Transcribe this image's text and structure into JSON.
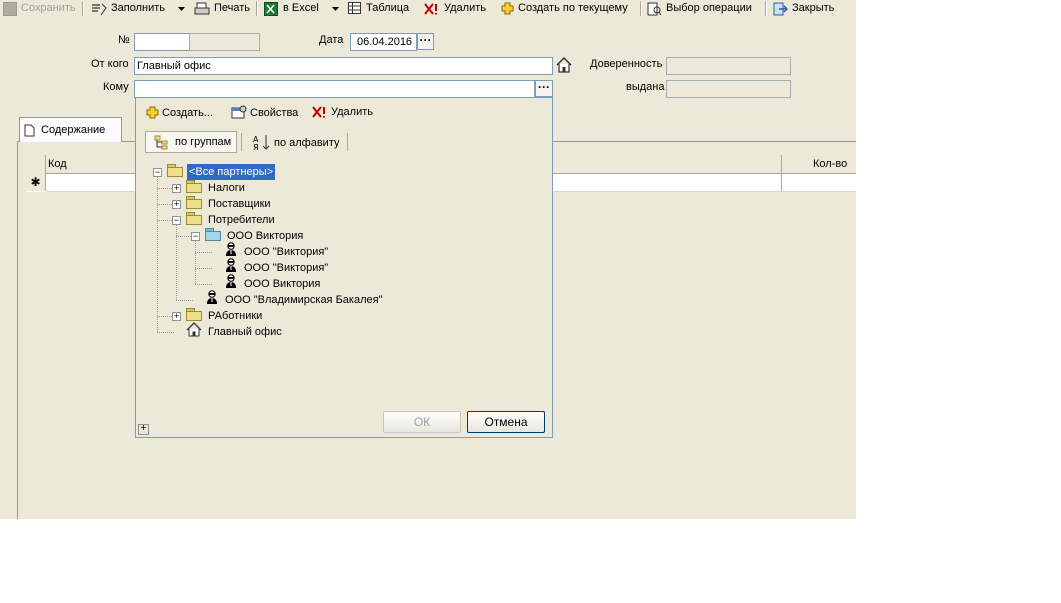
{
  "toolbar": {
    "save": "Сохранить",
    "fill": "Заполнить",
    "print": "Печать",
    "excel": "в Excel",
    "table": "Таблица",
    "delete": "Удалить",
    "create_from_current": "Создать по текущему",
    "choose_operation": "Выбор операции",
    "close": "Закрыть"
  },
  "form": {
    "number_label": "№",
    "number_value": "",
    "date_label": "Дата",
    "date_value": "06.04.2016",
    "from_label": "От кого",
    "from_value": "Главный офис",
    "to_label": "Кому",
    "to_value": "",
    "power_of_attorney_label": "Доверенность",
    "issued_label": "выдана",
    "power_of_attorney_value": "",
    "issued_value": ""
  },
  "tabs": {
    "content": "Содержание"
  },
  "grid": {
    "col_code": "Код",
    "col_qty": "Кол-во",
    "new_row_marker": "✱"
  },
  "popup": {
    "create": "Создать...",
    "properties": "Свойства",
    "delete": "Удалить",
    "by_groups": "по группам",
    "alphabetical": "по алфавиту",
    "ok": "ОК",
    "cancel": "Отмена",
    "tree": [
      {
        "label": "<Все партнеры>",
        "level": 0,
        "icon": "folder-open-icon",
        "expander": "−",
        "selected": true
      },
      {
        "label": "Налоги",
        "level": 1,
        "icon": "folder-icon",
        "expander": "+"
      },
      {
        "label": "Поставщики",
        "level": 1,
        "icon": "folder-icon",
        "expander": "+"
      },
      {
        "label": "Потребители",
        "level": 1,
        "icon": "folder-open-icon",
        "expander": "−"
      },
      {
        "label": "ООО Виктория",
        "level": 2,
        "icon": "folder-open-blue-icon",
        "expander": "−"
      },
      {
        "label": "ООО \"Виктория\"",
        "level": 3,
        "icon": "person-icon"
      },
      {
        "label": "ООО \"Виктория\"",
        "level": 3,
        "icon": "person-icon"
      },
      {
        "label": "ООО Виктория",
        "level": 3,
        "icon": "person-icon"
      },
      {
        "label": "ООО \"Владимирская Бакалея\"",
        "level": 2,
        "icon": "person-icon"
      },
      {
        "label": "РАботники",
        "level": 1,
        "icon": "folder-icon",
        "expander": "+"
      },
      {
        "label": "Главный офис",
        "level": 1,
        "icon": "house-icon"
      }
    ]
  },
  "colors": {
    "selection": "#316ac5",
    "field_border": "#7f9db9",
    "window_bg": "#ece9d8"
  }
}
